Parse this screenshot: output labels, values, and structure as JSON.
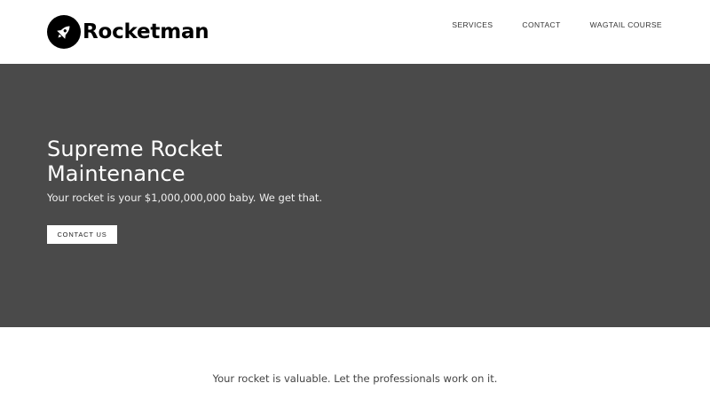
{
  "header": {
    "brand_name": "Rocketman",
    "logo_icon": "rocket-icon",
    "nav": [
      {
        "label": "SERVICES"
      },
      {
        "label": "CONTACT"
      },
      {
        "label": "WAGTAIL COURSE"
      }
    ]
  },
  "hero": {
    "title": "Supreme Rocket Maintenance",
    "subtitle": "Your rocket is your $1,000,000,000 baby. We get that.",
    "cta_label": "CONTACT US",
    "background_color": "#4a4a4a"
  },
  "intro": {
    "tagline": "Your rocket is valuable. Let the professionals work on it."
  }
}
